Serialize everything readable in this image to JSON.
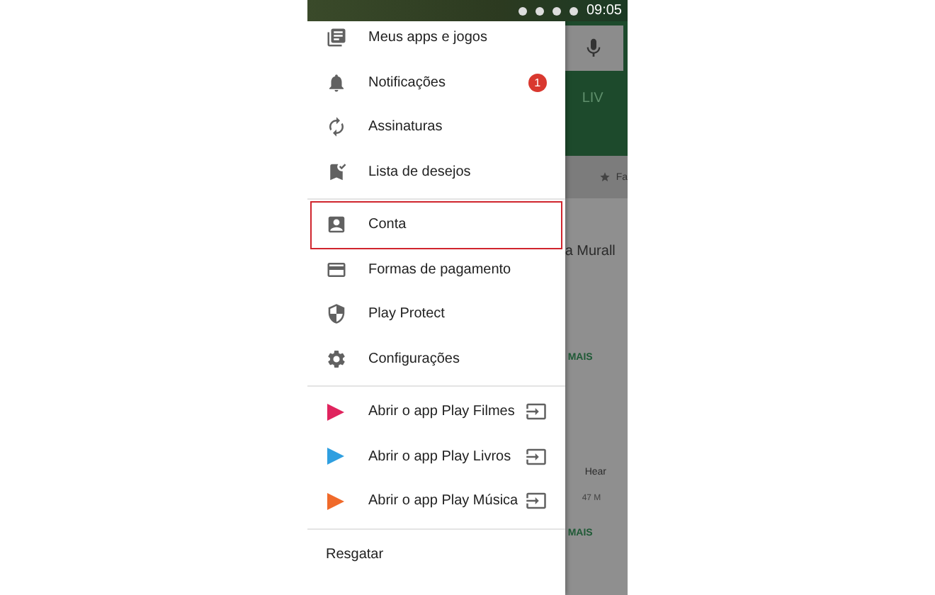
{
  "status_bar": {
    "time": "09:05"
  },
  "drawer": {
    "sections": [
      {
        "items": [
          {
            "label": "Meus apps e jogos",
            "kind": "plain",
            "highlighted": false
          },
          {
            "label": "Notificações",
            "kind": "plain",
            "highlighted": false,
            "badge": "1"
          },
          {
            "label": "Assinaturas",
            "kind": "plain",
            "highlighted": false
          },
          {
            "label": "Lista de desejos",
            "kind": "plain",
            "highlighted": false
          }
        ]
      },
      {
        "items": [
          {
            "label": "Conta",
            "kind": "plain",
            "highlighted": true
          },
          {
            "label": "Formas de pagamento",
            "kind": "plain",
            "highlighted": false
          },
          {
            "label": "Play Protect",
            "kind": "plain",
            "highlighted": false
          },
          {
            "label": "Configurações",
            "kind": "plain",
            "highlighted": false
          }
        ]
      },
      {
        "items": [
          {
            "label": "Abrir o app Play Filmes",
            "kind": "app-link",
            "highlighted": false,
            "color": "#e0245e"
          },
          {
            "label": "Abrir o app Play Livros",
            "kind": "app-link",
            "highlighted": false,
            "color": "#2f9fe0"
          },
          {
            "label": "Abrir o app Play Música",
            "kind": "app-link",
            "highlighted": false,
            "color": "#f06a2a"
          }
        ]
      },
      {
        "items": [
          {
            "label": "Resgatar",
            "kind": "text-only",
            "highlighted": false
          }
        ]
      }
    ]
  },
  "background": {
    "tab_label": "LIV",
    "tab_2": "Fa",
    "card_title": "a Murall",
    "more_1": "MAIS",
    "app_name": "Hear",
    "app_size": "47 M",
    "more_2": "MAIS"
  }
}
